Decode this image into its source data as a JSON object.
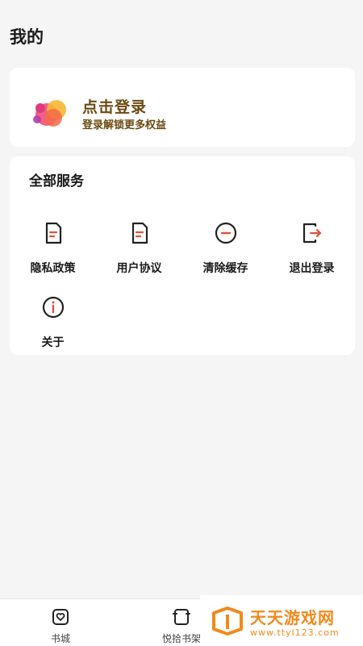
{
  "header": {
    "title": "我的"
  },
  "login_card": {
    "title": "点击登录",
    "subtitle": "登录解锁更多权益"
  },
  "services": {
    "title": "全部服务",
    "items": [
      {
        "label": "隐私政策",
        "icon": "document-icon"
      },
      {
        "label": "用户协议",
        "icon": "document-icon"
      },
      {
        "label": "清除缓存",
        "icon": "minus-circle-icon"
      },
      {
        "label": "退出登录",
        "icon": "logout-icon"
      },
      {
        "label": "关于",
        "icon": "info-circle-icon"
      }
    ]
  },
  "bottom_nav": {
    "items": [
      {
        "label": "书城",
        "icon": "bookstore-heart-icon"
      },
      {
        "label": "悦拾书架",
        "icon": "bookshelf-icon"
      }
    ]
  },
  "watermark": {
    "text": "天天游戏网",
    "url": "www.ttyl123.com"
  },
  "colors": {
    "accent": "#e0533a",
    "login_text": "#6b4b12",
    "watermark": "#f08a1c"
  }
}
